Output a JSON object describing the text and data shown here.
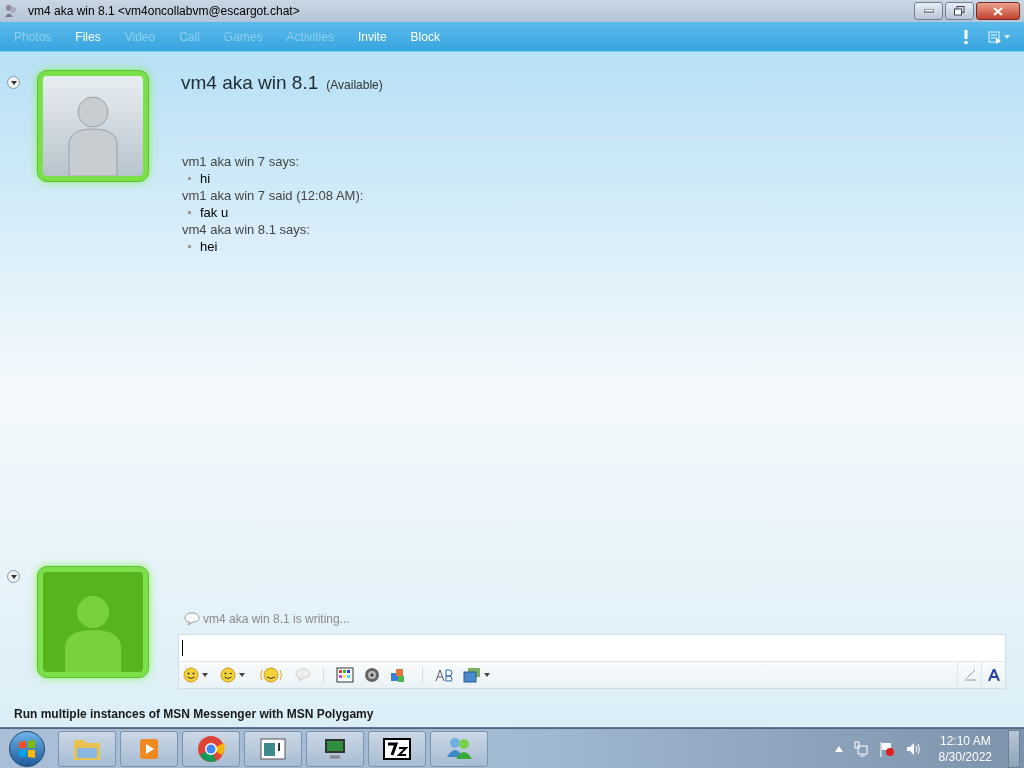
{
  "window": {
    "title": "vm4 aka win 8.1 <vm4oncollabvm@escargot.chat>"
  },
  "toolbar": {
    "items": [
      {
        "label": "Photos",
        "disabled": true
      },
      {
        "label": "Files",
        "disabled": false
      },
      {
        "label": "Video",
        "disabled": true
      },
      {
        "label": "Call",
        "disabled": true
      },
      {
        "label": "Games",
        "disabled": true
      },
      {
        "label": "Activities",
        "disabled": true
      },
      {
        "label": "Invite",
        "disabled": false
      },
      {
        "label": "Block",
        "disabled": false
      }
    ]
  },
  "contact": {
    "name": "vm4 aka win 8.1",
    "status": "(Available)"
  },
  "messages": [
    {
      "header": "vm1 aka win 7 says:",
      "lines": [
        "hi"
      ]
    },
    {
      "header": "vm1 aka win 7 said (12:08 AM):",
      "lines": [
        "fak u"
      ]
    },
    {
      "header": "vm4 aka win 8.1 says:",
      "lines": [
        "hei"
      ]
    }
  ],
  "typing_notice": "vm4 aka win 8.1 is writing...",
  "status_bar": "Run multiple instances of MSN Messenger with MSN Polygamy",
  "clock": {
    "time": "12:10 AM",
    "date": "8/30/2022"
  }
}
